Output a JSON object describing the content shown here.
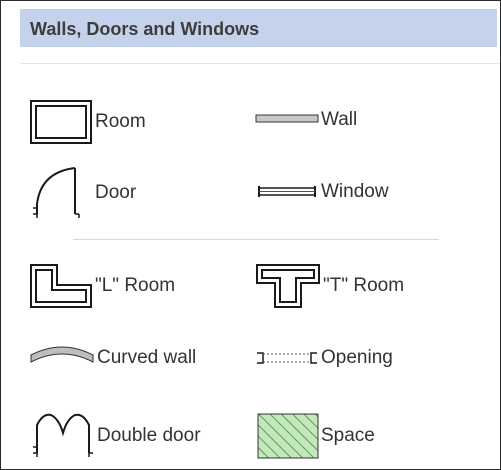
{
  "panel": {
    "title": "Walls, Doors and Windows"
  },
  "shapes": {
    "room": {
      "label": "Room",
      "icon": "room-icon"
    },
    "wall": {
      "label": "Wall",
      "icon": "wall-icon"
    },
    "door": {
      "label": "Door",
      "icon": "door-icon"
    },
    "window": {
      "label": "Window",
      "icon": "window-icon"
    },
    "l_room": {
      "label": "\"L\" Room",
      "icon": "l-room-icon"
    },
    "t_room": {
      "label": "\"T\" Room",
      "icon": "t-room-icon"
    },
    "curved_wall": {
      "label": "Curved wall",
      "icon": "curved-wall-icon"
    },
    "opening": {
      "label": "Opening",
      "icon": "opening-icon"
    },
    "double_door": {
      "label": "Double door",
      "icon": "double-door-icon"
    },
    "space": {
      "label": "Space",
      "icon": "space-icon"
    }
  },
  "colors": {
    "header_bg": "#c5d2ec",
    "icon_stroke": "#1a1a1a",
    "space_fill": "#b6dfae",
    "space_hatch": "#2d8a2d"
  }
}
